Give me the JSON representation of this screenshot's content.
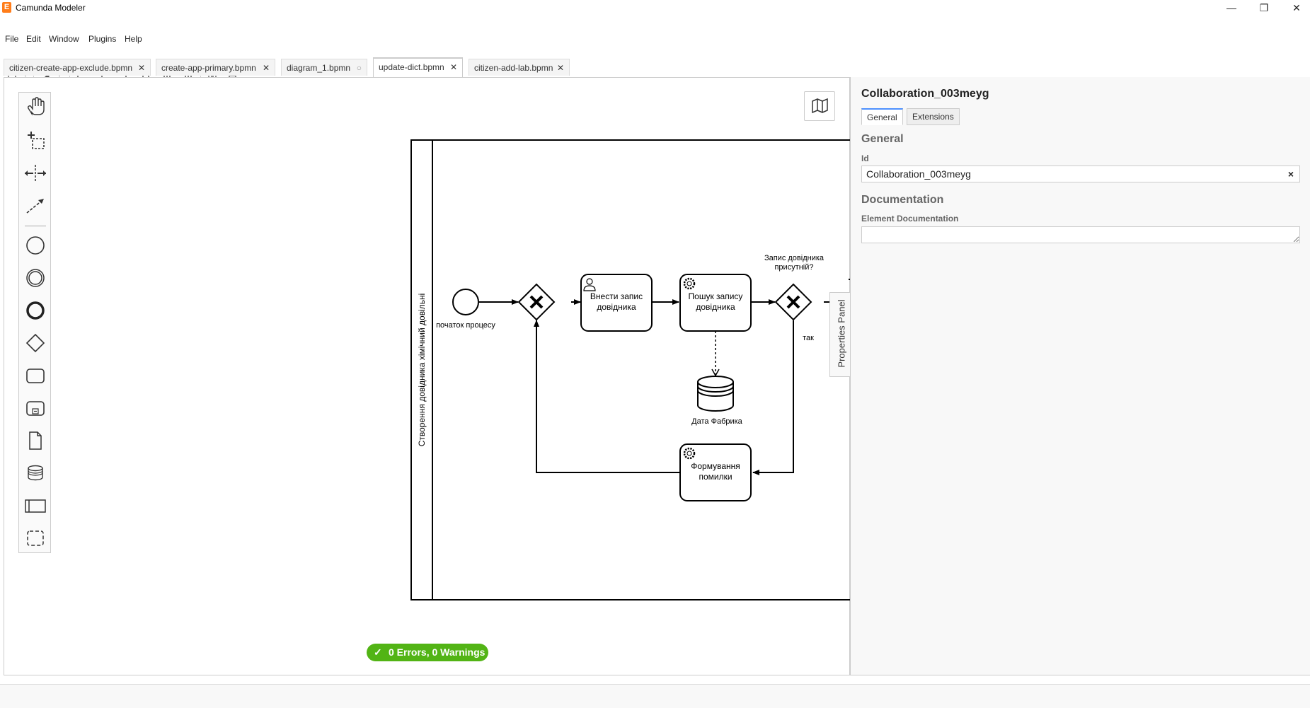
{
  "window": {
    "title": "Camunda Modeler",
    "logo_glyph": "E",
    "min_glyph": "—",
    "restore_glyph": "❐",
    "close_glyph": "✕"
  },
  "menu": {
    "items": [
      "File",
      "Edit",
      "Window",
      "Plugins",
      "Help"
    ]
  },
  "tabs": [
    {
      "label": "citizen-create-app-exclude.bpmn",
      "close": "✕",
      "active": false
    },
    {
      "label": "create-app-primary.bpmn",
      "close": "✕",
      "active": false
    },
    {
      "label": "diagram_1.bpmn",
      "close": "○",
      "active": false
    },
    {
      "label": "update-dict.bpmn",
      "close": "✕",
      "active": true
    },
    {
      "label": "citizen-add-lab.bpmn",
      "close": "✕",
      "active": false
    }
  ],
  "diagram": {
    "pool_label": "Створення довідника хімічний довільні",
    "start_event_label": "початок процесу",
    "task_enter": "Внести запис довідника",
    "task_enter_lines": [
      "Внести запис",
      "довідника"
    ],
    "task_search_lines": [
      "Пошук запису",
      "довідника"
    ],
    "datastore_label": "Дата Фабрика",
    "gateway_question_lines": [
      "Запис довідника",
      "присутній?"
    ],
    "flow_yes_label": "так",
    "task_error_lines": [
      "Формування",
      "помилки"
    ]
  },
  "properties": {
    "element_title": "Collaboration_003meyg",
    "tabs": [
      "General",
      "Extensions"
    ],
    "section_general": "General",
    "id_label": "Id",
    "id_value": "Collaboration_003meyg",
    "clear_glyph": "×",
    "section_documentation": "Documentation",
    "doc_label": "Element Documentation",
    "doc_value": "",
    "toggle_label": "Properties Panel"
  },
  "lint": {
    "check_glyph": "✓",
    "text": "0 Errors, 0 Warnings",
    "color": "#52b415"
  },
  "palette_tools": [
    "hand-tool",
    "lasso-tool",
    "space-tool",
    "connect-tool",
    "start-event",
    "intermediate-event",
    "end-event",
    "gateway",
    "task",
    "subprocess",
    "data-object",
    "data-store",
    "participant",
    "group"
  ]
}
